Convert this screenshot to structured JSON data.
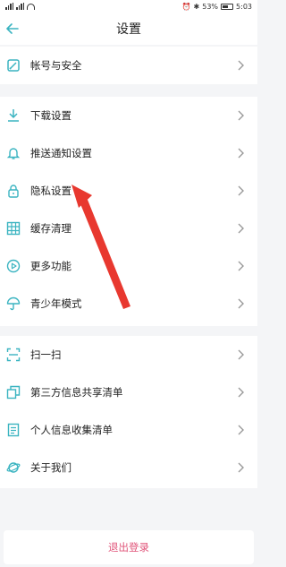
{
  "status_bar": {
    "battery": "53%",
    "time": "5:03"
  },
  "header": {
    "title": "设置"
  },
  "menu": {
    "account": {
      "label": "帐号与安全",
      "icon": "edit-icon"
    },
    "download": {
      "label": "下载设置",
      "icon": "download-icon"
    },
    "push": {
      "label": "推送通知设置",
      "icon": "bell-icon"
    },
    "privacy": {
      "label": "隐私设置",
      "icon": "lock-icon"
    },
    "cache": {
      "label": "缓存清理",
      "icon": "grid-icon"
    },
    "more": {
      "label": "更多功能",
      "icon": "play-icon"
    },
    "youth": {
      "label": "青少年模式",
      "icon": "umbrella-icon"
    },
    "scan": {
      "label": "扫一扫",
      "icon": "scan-icon"
    },
    "third_party": {
      "label": "第三方信息共享清单",
      "icon": "copy-icon"
    },
    "personal_info": {
      "label": "个人信息收集清单",
      "icon": "document-icon"
    },
    "about": {
      "label": "关于我们",
      "icon": "planet-icon"
    }
  },
  "logout": {
    "label": "退出登录"
  },
  "colors": {
    "accent": "#3bb4c1",
    "logout_text": "#e0557a",
    "annotation_arrow": "#e8382f",
    "background": "#f4f5f7"
  }
}
